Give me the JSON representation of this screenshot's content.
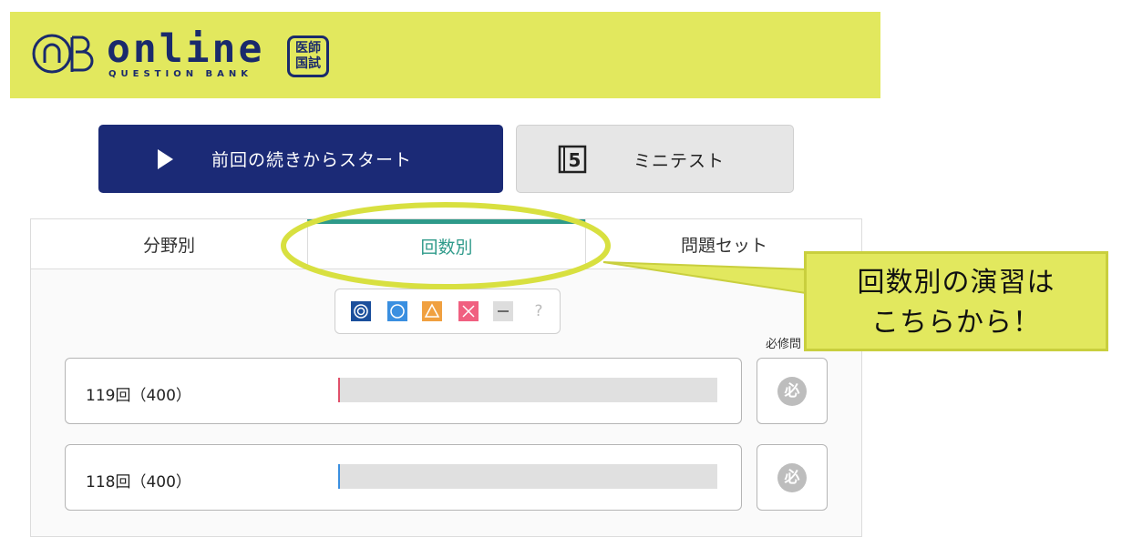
{
  "header": {
    "logo_text": "online",
    "logo_subtitle": "QUESTION BANK",
    "logo_badge_line1": "医師",
    "logo_badge_line2": "国試",
    "brand_color": "#e2e85e"
  },
  "actions": {
    "continue_label": "前回の続きからスタート",
    "minitest_label": "ミニテスト",
    "minitest_icon": "mini-test-5-icon"
  },
  "tabs": [
    {
      "label": "分野別",
      "active": false
    },
    {
      "label": "回数別",
      "active": true
    },
    {
      "label": "問題セット",
      "active": false
    }
  ],
  "filter": {
    "chips": [
      {
        "name": "double-circle",
        "symbol": "◎",
        "color": "#1b4f9c"
      },
      {
        "name": "circle",
        "symbol": "○",
        "color": "#3a8fe0"
      },
      {
        "name": "triangle",
        "symbol": "△",
        "color": "#f0a040"
      },
      {
        "name": "cross",
        "symbol": "✕",
        "color": "#f06080"
      },
      {
        "name": "dash",
        "symbol": "—",
        "color": "#dddddd"
      },
      {
        "name": "unknown",
        "symbol": "?",
        "color": "#ffffff"
      }
    ]
  },
  "must_column_label": "必修問",
  "exam_rows": [
    {
      "label": "119回（400）",
      "progress": 0.003,
      "progress_color": "#e0506a",
      "must_icon": "必"
    },
    {
      "label": "118回（400）",
      "progress": 0.004,
      "progress_color": "#3a8fe0",
      "must_icon": "必"
    }
  ],
  "callout": {
    "line1": "回数別の演習は",
    "line2": "こちらから！",
    "highlight_color": "#e2e85e"
  }
}
